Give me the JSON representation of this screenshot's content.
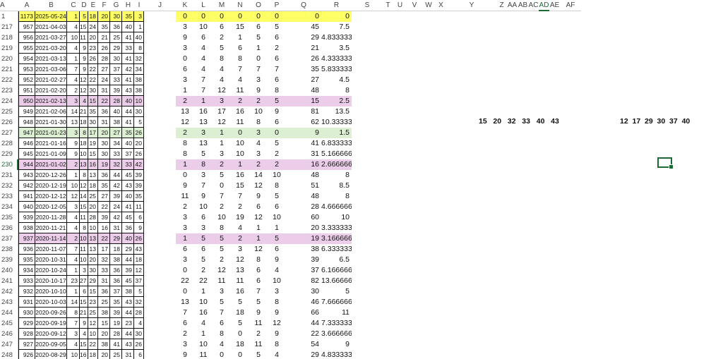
{
  "columns": [
    "A",
    "B",
    "C",
    "D",
    "E",
    "F",
    "G",
    "H",
    "I",
    "J",
    "K",
    "L",
    "M",
    "N",
    "O",
    "P",
    "Q",
    "R",
    "S",
    "T",
    "U",
    "V",
    "W",
    "X",
    "Y",
    "Z",
    "AA",
    "AB",
    "AC",
    "AD",
    "AE",
    "AF",
    "A"
  ],
  "selected_column": "AD",
  "selected_row": "230",
  "rows": [
    {
      "n": "1",
      "hl": "yellow",
      "a": [
        "1173",
        "2025-05-24",
        "1",
        "5",
        "18",
        "20",
        "30",
        "35",
        "3"
      ],
      "b": [
        "0",
        "0",
        "0",
        "0",
        "0",
        "0",
        "0",
        "0"
      ]
    },
    {
      "n": "217",
      "hl": "",
      "a": [
        "957",
        "2021-04-03",
        "4",
        "15",
        "24",
        "35",
        "36",
        "40",
        "1"
      ],
      "b": [
        "3",
        "10",
        "6",
        "15",
        "6",
        "5",
        "45",
        "7.5"
      ]
    },
    {
      "n": "218",
      "hl": "",
      "a": [
        "956",
        "2021-03-27",
        "10",
        "11",
        "20",
        "21",
        "25",
        "41",
        "40"
      ],
      "b": [
        "9",
        "6",
        "2",
        "1",
        "5",
        "6",
        "29",
        "4.83333333"
      ]
    },
    {
      "n": "219",
      "hl": "",
      "a": [
        "955",
        "2021-03-20",
        "4",
        "9",
        "23",
        "26",
        "29",
        "33",
        "8"
      ],
      "b": [
        "3",
        "4",
        "5",
        "6",
        "1",
        "2",
        "21",
        "3.5"
      ]
    },
    {
      "n": "220",
      "hl": "",
      "a": [
        "954",
        "2021-03-13",
        "1",
        "9",
        "26",
        "28",
        "30",
        "41",
        "32"
      ],
      "b": [
        "0",
        "4",
        "8",
        "8",
        "0",
        "6",
        "26",
        "4.33333333"
      ]
    },
    {
      "n": "221",
      "hl": "",
      "a": [
        "953",
        "2021-03-06",
        "7",
        "9",
        "22",
        "27",
        "37",
        "42",
        "34"
      ],
      "b": [
        "6",
        "4",
        "4",
        "7",
        "7",
        "7",
        "35",
        "5.83333333"
      ]
    },
    {
      "n": "222",
      "hl": "",
      "a": [
        "952",
        "2021-02-27",
        "4",
        "12",
        "22",
        "24",
        "33",
        "41",
        "38"
      ],
      "b": [
        "3",
        "7",
        "4",
        "4",
        "3",
        "6",
        "27",
        "4.5"
      ]
    },
    {
      "n": "223",
      "hl": "",
      "a": [
        "951",
        "2021-02-20",
        "2",
        "12",
        "30",
        "31",
        "39",
        "43",
        "38"
      ],
      "b": [
        "1",
        "7",
        "12",
        "11",
        "9",
        "8",
        "48",
        "8"
      ]
    },
    {
      "n": "224",
      "hl": "pink",
      "a": [
        "950",
        "2021-02-13",
        "3",
        "4",
        "15",
        "22",
        "28",
        "40",
        "10"
      ],
      "b": [
        "2",
        "1",
        "3",
        "2",
        "2",
        "5",
        "15",
        "2.5"
      ]
    },
    {
      "n": "225",
      "hl": "",
      "a": [
        "949",
        "2021-02-06",
        "14",
        "21",
        "35",
        "36",
        "40",
        "44",
        "30"
      ],
      "b": [
        "13",
        "16",
        "17",
        "16",
        "10",
        "9",
        "81",
        "13.5"
      ]
    },
    {
      "n": "226",
      "hl": "",
      "a": [
        "948",
        "2021-01-30",
        "13",
        "18",
        "30",
        "31",
        "38",
        "41",
        "5"
      ],
      "b": [
        "12",
        "13",
        "12",
        "11",
        "8",
        "6",
        "62",
        "10.3333333"
      ]
    },
    {
      "n": "227",
      "hl": "green",
      "a": [
        "947",
        "2021-01-23",
        "3",
        "8",
        "17",
        "20",
        "27",
        "35",
        "26"
      ],
      "b": [
        "2",
        "3",
        "1",
        "0",
        "3",
        "0",
        "9",
        "1.5"
      ]
    },
    {
      "n": "228",
      "hl": "",
      "a": [
        "946",
        "2021-01-16",
        "9",
        "18",
        "19",
        "30",
        "34",
        "40",
        "20"
      ],
      "b": [
        "8",
        "13",
        "1",
        "10",
        "4",
        "5",
        "41",
        "6.83333333"
      ]
    },
    {
      "n": "229",
      "hl": "",
      "a": [
        "945",
        "2021-01-09",
        "9",
        "10",
        "15",
        "30",
        "33",
        "37",
        "26"
      ],
      "b": [
        "8",
        "5",
        "3",
        "10",
        "3",
        "2",
        "31",
        "5.16666667"
      ]
    },
    {
      "n": "230",
      "hl": "pink",
      "a": [
        "944",
        "2021-01-02",
        "2",
        "13",
        "16",
        "19",
        "32",
        "33",
        "42"
      ],
      "b": [
        "1",
        "8",
        "2",
        "1",
        "2",
        "2",
        "16",
        "2.66666667"
      ]
    },
    {
      "n": "231",
      "hl": "",
      "a": [
        "943",
        "2020-12-26",
        "1",
        "8",
        "13",
        "36",
        "44",
        "45",
        "39"
      ],
      "b": [
        "0",
        "3",
        "5",
        "16",
        "14",
        "10",
        "48",
        "8"
      ]
    },
    {
      "n": "232",
      "hl": "",
      "a": [
        "942",
        "2020-12-19",
        "10",
        "12",
        "18",
        "35",
        "42",
        "43",
        "39"
      ],
      "b": [
        "9",
        "7",
        "0",
        "15",
        "12",
        "8",
        "51",
        "8.5"
      ]
    },
    {
      "n": "233",
      "hl": "",
      "a": [
        "941",
        "2020-12-12",
        "12",
        "14",
        "25",
        "27",
        "39",
        "40",
        "35"
      ],
      "b": [
        "11",
        "9",
        "7",
        "7",
        "9",
        "5",
        "48",
        "8"
      ]
    },
    {
      "n": "234",
      "hl": "",
      "a": [
        "940",
        "2020-12-05",
        "3",
        "15",
        "20",
        "22",
        "24",
        "41",
        "11"
      ],
      "b": [
        "2",
        "10",
        "2",
        "2",
        "6",
        "6",
        "28",
        "4.66666667"
      ]
    },
    {
      "n": "235",
      "hl": "",
      "a": [
        "939",
        "2020-11-28",
        "4",
        "11",
        "28",
        "39",
        "42",
        "45",
        "6"
      ],
      "b": [
        "3",
        "6",
        "10",
        "19",
        "12",
        "10",
        "60",
        "10"
      ]
    },
    {
      "n": "236",
      "hl": "",
      "a": [
        "938",
        "2020-11-21",
        "4",
        "8",
        "10",
        "16",
        "31",
        "36",
        "9"
      ],
      "b": [
        "3",
        "3",
        "8",
        "4",
        "1",
        "1",
        "20",
        "3.33333333"
      ]
    },
    {
      "n": "237",
      "hl": "pink",
      "a": [
        "937",
        "2020-11-14",
        "2",
        "10",
        "13",
        "22",
        "29",
        "40",
        "26"
      ],
      "b": [
        "1",
        "5",
        "5",
        "2",
        "1",
        "5",
        "19",
        "3.16666667"
      ]
    },
    {
      "n": "238",
      "hl": "",
      "a": [
        "936",
        "2020-11-07",
        "7",
        "11",
        "13",
        "17",
        "18",
        "29",
        "43"
      ],
      "b": [
        "6",
        "6",
        "5",
        "3",
        "12",
        "6",
        "38",
        "6.33333333"
      ]
    },
    {
      "n": "239",
      "hl": "",
      "a": [
        "935",
        "2020-10-31",
        "4",
        "10",
        "20",
        "32",
        "38",
        "44",
        "18"
      ],
      "b": [
        "3",
        "5",
        "2",
        "12",
        "8",
        "9",
        "39",
        "6.5"
      ]
    },
    {
      "n": "240",
      "hl": "",
      "a": [
        "934",
        "2020-10-24",
        "1",
        "3",
        "30",
        "33",
        "36",
        "39",
        "12"
      ],
      "b": [
        "0",
        "2",
        "12",
        "13",
        "6",
        "4",
        "37",
        "6.16666667"
      ]
    },
    {
      "n": "241",
      "hl": "",
      "a": [
        "933",
        "2020-10-17",
        "23",
        "27",
        "29",
        "31",
        "36",
        "45",
        "37"
      ],
      "b": [
        "22",
        "22",
        "11",
        "11",
        "6",
        "10",
        "82",
        "13.6666667"
      ]
    },
    {
      "n": "242",
      "hl": "",
      "a": [
        "932",
        "2020-10-10",
        "1",
        "6",
        "15",
        "36",
        "37",
        "38",
        "5"
      ],
      "b": [
        "0",
        "1",
        "3",
        "16",
        "7",
        "3",
        "30",
        "5"
      ]
    },
    {
      "n": "243",
      "hl": "",
      "a": [
        "931",
        "2020-10-03",
        "14",
        "15",
        "23",
        "25",
        "35",
        "43",
        "32"
      ],
      "b": [
        "13",
        "10",
        "5",
        "5",
        "5",
        "8",
        "46",
        "7.66666667"
      ]
    },
    {
      "n": "244",
      "hl": "",
      "a": [
        "930",
        "2020-09-26",
        "8",
        "21",
        "25",
        "38",
        "39",
        "44",
        "28"
      ],
      "b": [
        "7",
        "16",
        "7",
        "18",
        "9",
        "9",
        "66",
        "11"
      ]
    },
    {
      "n": "245",
      "hl": "",
      "a": [
        "929",
        "2020-09-19",
        "7",
        "9",
        "12",
        "15",
        "19",
        "23",
        "4"
      ],
      "b": [
        "6",
        "4",
        "6",
        "5",
        "11",
        "12",
        "44",
        "7.33333333"
      ]
    },
    {
      "n": "246",
      "hl": "",
      "a": [
        "928",
        "2020-09-12",
        "3",
        "4",
        "10",
        "20",
        "28",
        "44",
        "30"
      ],
      "b": [
        "2",
        "1",
        "8",
        "0",
        "2",
        "9",
        "22",
        "3.66666667"
      ]
    },
    {
      "n": "247",
      "hl": "",
      "a": [
        "927",
        "2020-09-05",
        "4",
        "15",
        "22",
        "38",
        "41",
        "43",
        "26"
      ],
      "b": [
        "3",
        "10",
        "4",
        "18",
        "11",
        "8",
        "54",
        "9"
      ]
    },
    {
      "n": "248",
      "hl": "",
      "a": [
        "926",
        "2020-08-29",
        "10",
        "16",
        "18",
        "20",
        "25",
        "31",
        "6"
      ],
      "b": [
        "9",
        "11",
        "0",
        "0",
        "5",
        "4",
        "29",
        "4.83333333"
      ]
    }
  ],
  "notes": {
    "set1": "15   20   32   33   40   43",
    "set2": "12  17  29  30  37  40"
  },
  "colors": {
    "yellow": "#ffff66",
    "pink": "#ebcdea",
    "green": "#dcefd3",
    "selection": "#1b6b37"
  }
}
